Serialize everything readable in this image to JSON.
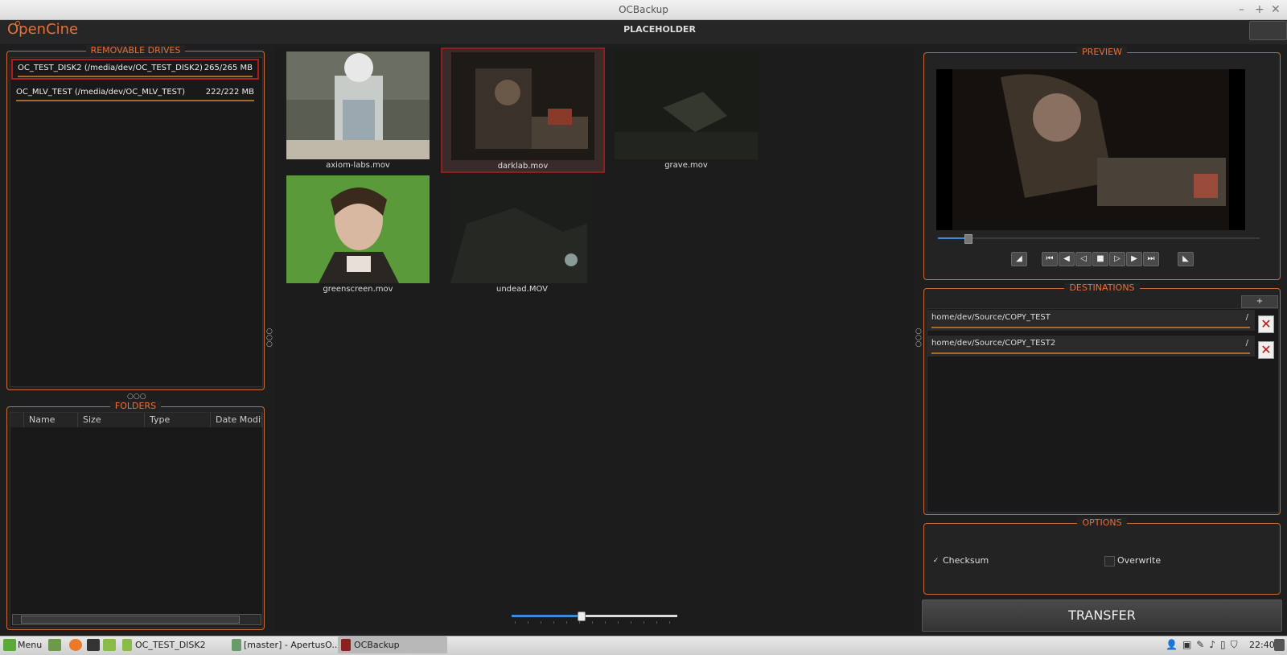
{
  "window": {
    "title": "OCBackup",
    "controls": [
      "–",
      "+",
      "✕"
    ]
  },
  "header": {
    "logo": "OpenCine",
    "title": "PLACEHOLDER"
  },
  "drives": {
    "title": "REMOVABLE DRIVES",
    "items": [
      {
        "name": "OC_TEST_DISK2 (/media/dev/OC_TEST_DISK2)",
        "size": "265/265 MB"
      },
      {
        "name": "OC_MLV_TEST (/media/dev/OC_MLV_TEST)",
        "size": "222/222 MB"
      }
    ]
  },
  "folders": {
    "title": "FOLDERS",
    "columns": [
      "Name",
      "Size",
      "Type",
      "Date Modified"
    ]
  },
  "clips": [
    {
      "label": "axiom-labs.mov"
    },
    {
      "label": "darklab.mov"
    },
    {
      "label": "grave.mov"
    },
    {
      "label": "greenscreen.mov"
    },
    {
      "label": "undead.MOV"
    }
  ],
  "preview": {
    "title": "PREVIEW"
  },
  "destinations": {
    "title": "DESTINATIONS",
    "add_label": "+",
    "items": [
      {
        "path": "home/dev/Source/COPY_TEST",
        "slash": "/"
      },
      {
        "path": "home/dev/Source/COPY_TEST2",
        "slash": "/"
      }
    ]
  },
  "options": {
    "title": "OPTIONS",
    "checksum": {
      "label": "Checksum",
      "checked": true,
      "mark": "✓"
    },
    "overwrite": {
      "label": "Overwrite",
      "checked": false
    }
  },
  "transfer_label": "TRANSFER",
  "taskbar": {
    "menu": "Menu",
    "tasks": [
      "OC_TEST_DISK2",
      "[master] - ApertusO...",
      "OCBackup"
    ],
    "clock": "22:40"
  },
  "colors": {
    "accent": "#e86f3a",
    "selection": "#b01c1c",
    "progress": "#3a8ad8"
  }
}
